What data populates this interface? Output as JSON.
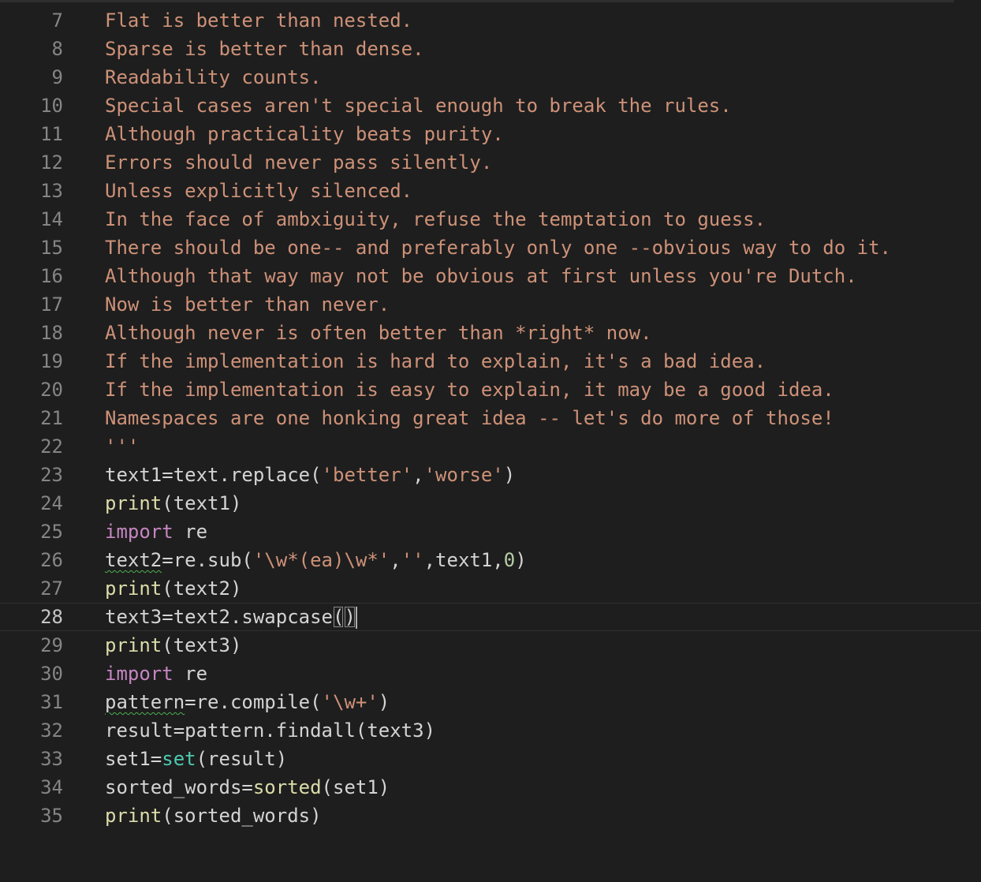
{
  "editor": {
    "lines": [
      {
        "num": "7",
        "text": "Flat is better than nested."
      },
      {
        "num": "8",
        "text": "Sparse is better than dense."
      },
      {
        "num": "9",
        "text": "Readability counts."
      },
      {
        "num": "10",
        "text": "Special cases aren't special enough to break the rules."
      },
      {
        "num": "11",
        "text": "Although practicality beats purity."
      },
      {
        "num": "12",
        "text": "Errors should never pass silently."
      },
      {
        "num": "13",
        "text": "Unless explicitly silenced."
      },
      {
        "num": "14",
        "text": "In the face of ambxiguity, refuse the temptation to guess."
      },
      {
        "num": "15",
        "text": "There should be one-- and preferably only one --obvious way to do it."
      },
      {
        "num": "16",
        "text": "Although that way may not be obvious at first unless you're Dutch."
      },
      {
        "num": "17",
        "text": "Now is better than never."
      },
      {
        "num": "18",
        "text": "Although never is often better than *right* now."
      },
      {
        "num": "19",
        "text": "If the implementation is hard to explain, it's a bad idea."
      },
      {
        "num": "20",
        "text": "If the implementation is easy to explain, it may be a good idea."
      },
      {
        "num": "21",
        "text": "Namespaces are one honking great idea -- let's do more of those!"
      },
      {
        "num": "22",
        "text": "'''"
      },
      {
        "num": "23",
        "tokens": [
          [
            "plain",
            "text1=text.replace("
          ],
          [
            "str",
            "'better'"
          ],
          [
            "plain",
            ","
          ],
          [
            "str",
            "'worse'"
          ],
          [
            "plain",
            ")"
          ]
        ]
      },
      {
        "num": "24",
        "tokens": [
          [
            "fn",
            "print"
          ],
          [
            "plain",
            "(text1)"
          ]
        ]
      },
      {
        "num": "25",
        "tokens": [
          [
            "kw",
            "import"
          ],
          [
            "plain",
            " re"
          ]
        ]
      },
      {
        "num": "26",
        "tokens": [
          [
            "squiggle",
            "text2"
          ],
          [
            "plain",
            "=re.sub("
          ],
          [
            "str",
            "'\\w*(ea)\\w*'"
          ],
          [
            "plain",
            ","
          ],
          [
            "str",
            "''"
          ],
          [
            "plain",
            ",text1,"
          ],
          [
            "num",
            "0"
          ],
          [
            "plain",
            ")"
          ]
        ]
      },
      {
        "num": "27",
        "tokens": [
          [
            "fn",
            "print"
          ],
          [
            "plain",
            "(text2)"
          ]
        ]
      },
      {
        "num": "28",
        "current": true,
        "tokens": [
          [
            "plain",
            "text3=text2.swapcase"
          ],
          [
            "match",
            "("
          ],
          [
            "match",
            ")"
          ],
          [
            "cursor",
            ""
          ]
        ]
      },
      {
        "num": "29",
        "tokens": [
          [
            "fn",
            "print"
          ],
          [
            "plain",
            "(text3)"
          ]
        ]
      },
      {
        "num": "30",
        "tokens": [
          [
            "kw",
            "import"
          ],
          [
            "plain",
            " re"
          ]
        ]
      },
      {
        "num": "31",
        "tokens": [
          [
            "squiggle",
            "pattern"
          ],
          [
            "plain",
            "=re.compile("
          ],
          [
            "str",
            "'\\w+'"
          ],
          [
            "plain",
            ")"
          ]
        ]
      },
      {
        "num": "32",
        "tokens": [
          [
            "plain",
            "result=pattern.findall(text3)"
          ]
        ]
      },
      {
        "num": "33",
        "tokens": [
          [
            "plain",
            "set1="
          ],
          [
            "cls",
            "set"
          ],
          [
            "plain",
            "(result)"
          ]
        ]
      },
      {
        "num": "34",
        "tokens": [
          [
            "plain",
            "sorted_words="
          ],
          [
            "fn",
            "sorted"
          ],
          [
            "plain",
            "(set1)"
          ]
        ]
      },
      {
        "num": "35",
        "tokens": [
          [
            "fn",
            "print"
          ],
          [
            "plain",
            "(sorted_words)"
          ]
        ]
      }
    ]
  }
}
